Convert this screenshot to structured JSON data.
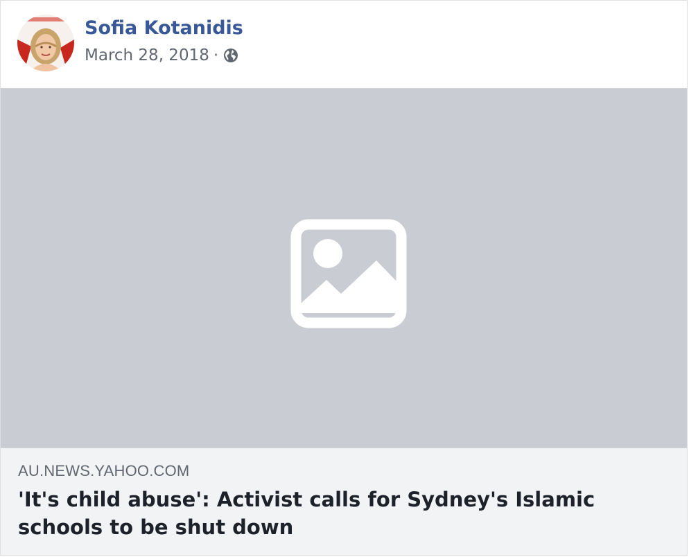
{
  "post": {
    "author": "Sofia Kotanidis",
    "date": "March 28, 2018",
    "separator": "·",
    "privacy_icon": "globe-icon",
    "avatar_icon": "profile-photo"
  },
  "link": {
    "image_icon": "image-placeholder-icon",
    "domain": "AU.NEWS.YAHOO.COM",
    "title": "'It's child abuse': Activist calls for Sydney's Islamic schools to be shut down"
  },
  "colors": {
    "author_name": "#385898",
    "meta_text": "#606770",
    "image_bg": "#c9ccd3",
    "info_bg": "#f2f3f5",
    "title_text": "#1d2129"
  }
}
